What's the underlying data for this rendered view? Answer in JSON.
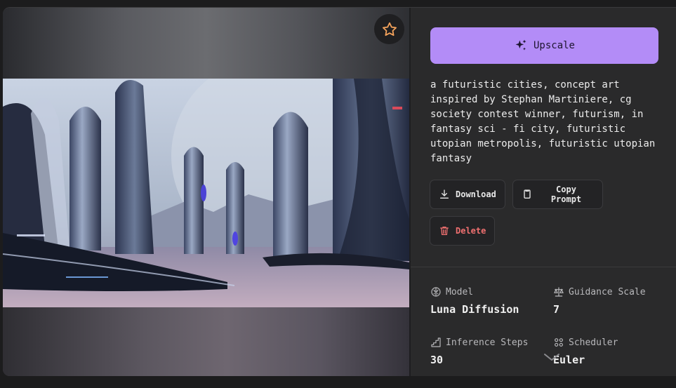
{
  "upscale": {
    "label": "Upscale"
  },
  "prompt": "a futuristic cities, concept art inspired by Stephan Martiniere, cg society contest winner, futurism, in fantasy sci - fi city, futuristic utopian metropolis, futuristic utopian fantasy",
  "actions": {
    "download": "Download",
    "copy_prompt": "Copy Prompt",
    "delete": "Delete"
  },
  "details": {
    "model": {
      "label": "Model",
      "value": "Luna Diffusion"
    },
    "guidance": {
      "label": "Guidance Scale",
      "value": "7"
    },
    "steps": {
      "label": "Inference Steps",
      "value": "30"
    },
    "scheduler": {
      "label": "Scheduler",
      "value": "Euler"
    }
  },
  "colors": {
    "accent": "#b38cf7",
    "danger": "#f07070",
    "star": "#f5a35c"
  },
  "icons": {
    "favorite": "star-icon",
    "upscale": "sparkles-icon",
    "download": "download-icon",
    "copy": "copy-icon",
    "delete": "trash-icon",
    "model": "brain-icon",
    "guidance": "scale-icon",
    "steps": "steps-icon",
    "scheduler": "scheduler-icon",
    "more": "chevron-down-icon"
  }
}
